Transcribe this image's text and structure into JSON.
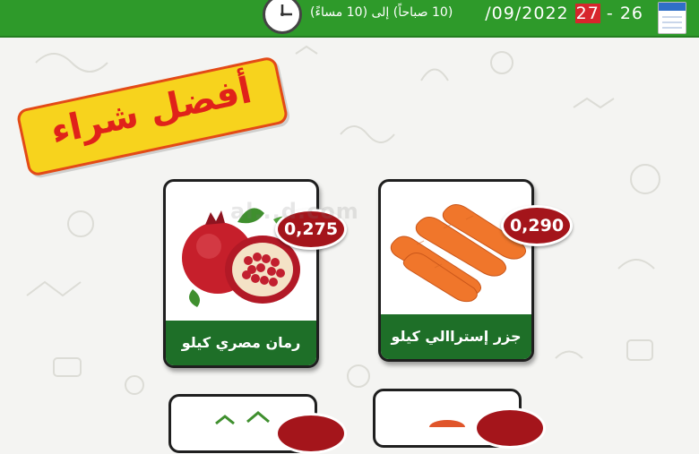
{
  "header": {
    "date_start_day": "26",
    "date_separator": "-",
    "date_end_day": "27",
    "date_rest": "/09/2022",
    "hours": "(10 صباحاً) إلى (10 مساءً)"
  },
  "banner": {
    "title": "أفضل شراء"
  },
  "watermark": "al...d.com",
  "products": [
    {
      "name": "رمان مصري كيلو",
      "price": "0,275",
      "icon": "pomegranate-image"
    },
    {
      "name": "جزر إستراالي كيلو",
      "price": "0,290",
      "icon": "carrot-image"
    }
  ],
  "colors": {
    "header_green": "#2e9a2a",
    "label_green": "#1e6f28",
    "price_red": "#a4151b",
    "banner_yellow": "#f7d31d",
    "banner_text_red": "#e0221a",
    "date_highlight": "#d7262c"
  }
}
